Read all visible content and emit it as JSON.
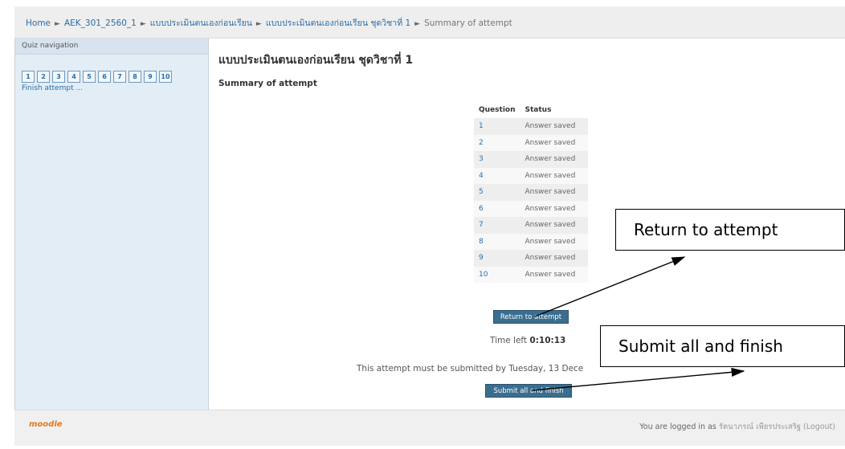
{
  "breadcrumb": {
    "items": [
      "Home",
      "AEK_301_2560_1",
      "แบบประเมินตนเองก่อนเรียน",
      "แบบประเมินตนเองก่อนเรียน ชุดวิชาที่ 1",
      "Summary of attempt"
    ],
    "separator": "►"
  },
  "sidebar": {
    "title": "Quiz navigation",
    "questions": [
      "1",
      "2",
      "3",
      "4",
      "5",
      "6",
      "7",
      "8",
      "9",
      "10"
    ],
    "finish_link": "Finish attempt ..."
  },
  "main": {
    "title": "แบบประเมินตนเองก่อนเรียน ชุดวิชาที่ 1",
    "subtitle": "Summary of attempt",
    "table": {
      "headers": [
        "Question",
        "Status"
      ],
      "rows": [
        {
          "q": "1",
          "status": "Answer saved"
        },
        {
          "q": "2",
          "status": "Answer saved"
        },
        {
          "q": "3",
          "status": "Answer saved"
        },
        {
          "q": "4",
          "status": "Answer saved"
        },
        {
          "q": "5",
          "status": "Answer saved"
        },
        {
          "q": "6",
          "status": "Answer saved"
        },
        {
          "q": "7",
          "status": "Answer saved"
        },
        {
          "q": "8",
          "status": "Answer saved"
        },
        {
          "q": "9",
          "status": "Answer saved"
        },
        {
          "q": "10",
          "status": "Answer saved"
        }
      ]
    },
    "return_button": "Return to attempt",
    "time_left_label": "Time left",
    "time_left_value": "0:10:13",
    "notice": "This attempt must be submitted by Tuesday, 13 Dece",
    "submit_button": "Submit all and finish"
  },
  "footer": {
    "logo": "moodle",
    "logged_in_prefix": "You are logged in as",
    "user_name": "รัตนาภรณ์ เพียรประเสริฐ",
    "logout": "(Logout)"
  },
  "callouts": {
    "return": "Return to attempt",
    "submit": "Submit all and finish"
  },
  "colors": {
    "sidebar_bg": "#e3edf5",
    "button_bg": "#3b6e8e",
    "link": "#2a6ea6"
  }
}
